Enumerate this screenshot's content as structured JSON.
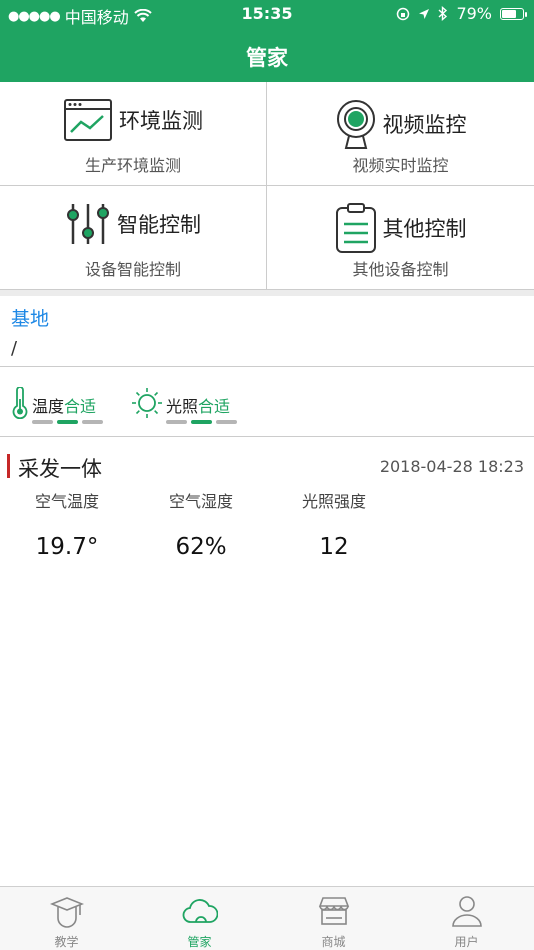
{
  "status_bar": {
    "signal_dots": "●●●●●",
    "carrier": "中国移动",
    "time": "15:35",
    "battery_percent": "79%",
    "battery_level": 0.79
  },
  "nav": {
    "title": "管家"
  },
  "grid": [
    {
      "title": "环境监测",
      "subtitle": "生产环境监测",
      "icon": "monitor-chart-icon"
    },
    {
      "title": "视频监控",
      "subtitle": "视频实时监控",
      "icon": "webcam-icon"
    },
    {
      "title": "智能控制",
      "subtitle": "设备智能控制",
      "icon": "sliders-icon"
    },
    {
      "title": "其他控制",
      "subtitle": "其他设备控制",
      "icon": "clipboard-icon"
    }
  ],
  "base": {
    "title": "基地",
    "path": "/"
  },
  "indicators": [
    {
      "label": "温度",
      "status": "合适",
      "icon": "thermometer-icon",
      "level": 2,
      "levels": 3
    },
    {
      "label": "光照",
      "status": "合适",
      "icon": "sun-icon",
      "level": 2,
      "levels": 3
    }
  ],
  "device": {
    "name": "采发一体",
    "time": "2018-04-28 18:23",
    "metrics": [
      {
        "label": "空气温度",
        "value": "19.7°"
      },
      {
        "label": "空气湿度",
        "value": "62%"
      },
      {
        "label": "光照强度",
        "value": "12"
      }
    ]
  },
  "tabs": [
    {
      "label": "教学",
      "icon": "graduation-cap-icon",
      "active": false
    },
    {
      "label": "管家",
      "icon": "cloud-icon",
      "active": true
    },
    {
      "label": "商城",
      "icon": "store-icon",
      "active": false
    },
    {
      "label": "用户",
      "icon": "user-icon",
      "active": false
    }
  ],
  "colors": {
    "brand_green": "#1fa462",
    "link_blue": "#1e88e5",
    "accent_red": "#c62828"
  }
}
